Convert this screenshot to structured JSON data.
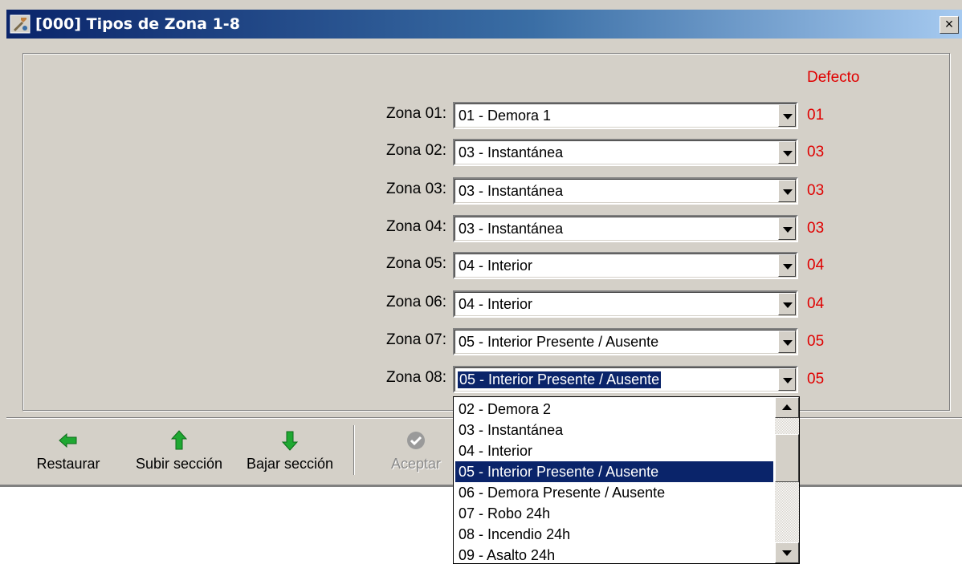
{
  "window": {
    "title": "[000] Tipos de Zona 1-8",
    "close_label": "×",
    "icon": "wrench-tool-icon"
  },
  "panel": {
    "defecto_header": "Defecto",
    "zones": [
      {
        "label": "Zona 01:",
        "value": "01 - Demora 1",
        "default": "01"
      },
      {
        "label": "Zona 02:",
        "value": "03 - Instantánea",
        "default": "03"
      },
      {
        "label": "Zona 03:",
        "value": "03 - Instantánea",
        "default": "03"
      },
      {
        "label": "Zona 04:",
        "value": "03 - Instantánea",
        "default": "03"
      },
      {
        "label": "Zona 05:",
        "value": "04 - Interior",
        "default": "04"
      },
      {
        "label": "Zona 06:",
        "value": "04 - Interior",
        "default": "04"
      },
      {
        "label": "Zona 07:",
        "value": "05 - Interior Presente / Ausente",
        "default": "05"
      },
      {
        "label": "Zona 08:",
        "value": "05 - Interior Presente / Ausente",
        "default": "05"
      }
    ]
  },
  "toolbar": {
    "restaurar": {
      "label": "Restaurar",
      "icon": "arrow-left-green-icon"
    },
    "subir": {
      "label": "Subir sección",
      "icon": "arrow-up-green-icon"
    },
    "bajar": {
      "label": "Bajar sección",
      "icon": "arrow-down-green-icon"
    },
    "aceptar": {
      "label": "Aceptar",
      "icon": "checkmark-disabled-icon"
    }
  },
  "dropdown": {
    "items": [
      "02 - Demora 2",
      "03 - Instantánea",
      "04 - Interior",
      "05 - Interior Presente / Ausente",
      "06 - Demora Presente / Ausente",
      "07 - Robo 24h",
      "08 - Incendio 24h",
      "09 - Asalto 24h"
    ],
    "selected": "05 - Interior Presente / Ausente"
  },
  "colors": {
    "title_gradient_start": "#0a246a",
    "title_gradient_end": "#a6caf0",
    "default_value_color": "#e00000",
    "selection": "#0a246a",
    "face": "#d4d0c8",
    "toolbar_icon": "#1fa832"
  }
}
